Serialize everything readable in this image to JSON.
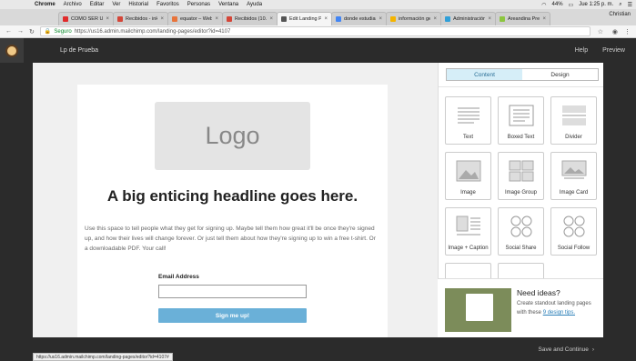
{
  "macos": {
    "menu": [
      "Chrome",
      "Archivo",
      "Editar",
      "Ver",
      "Historial",
      "Favoritos",
      "Personas",
      "Ventana",
      "Ayuda"
    ],
    "battery": "44%",
    "clock": "Jue 1:25 p. m."
  },
  "browser": {
    "tabs": [
      {
        "label": "CÓMO SER Un",
        "color": "#e02b2b",
        "active": false
      },
      {
        "label": "Recibidos - ink",
        "color": "#d44638",
        "active": false
      },
      {
        "label": "equator – Web",
        "color": "#e8743b",
        "active": false
      },
      {
        "label": "Recibidos (10.6",
        "color": "#d44638",
        "active": false
      },
      {
        "label": "Edit Landing Pa",
        "color": "#555555",
        "active": true
      },
      {
        "label": "donde estudiar",
        "color": "#4285f4",
        "active": false
      },
      {
        "label": "información ge",
        "color": "#f4b400",
        "active": false
      },
      {
        "label": "Administración",
        "color": "#2f9fd8",
        "active": false
      },
      {
        "label": "Areandina Pres",
        "color": "#8cc63f",
        "active": false
      }
    ],
    "user": "Christian",
    "secure_label": "Seguro",
    "url": "https://us16.admin.mailchimp.com/landing-pages/editor?id=4107"
  },
  "app": {
    "page_name": "Lp de Prueba",
    "help": "Help",
    "preview": "Preview"
  },
  "landing": {
    "logo": "Logo",
    "headline": "A big enticing headline goes here.",
    "body": "Use this space to tell people what they get for signing up. Maybe tell them how great it'll be once they're signed up, and how their lives will change forever. Or just tell them about how they're signing up to win a free t-shirt. Or a downloadable PDF. Your call!",
    "email_label": "Email Address",
    "signup_button": "Sign me up!"
  },
  "panel": {
    "tab_content": "Content",
    "tab_design": "Design",
    "blocks": [
      {
        "label": "Text",
        "icon": "text-block-icon"
      },
      {
        "label": "Boxed Text",
        "icon": "boxed-text-icon"
      },
      {
        "label": "Divider",
        "icon": "divider-icon"
      },
      {
        "label": "Image",
        "icon": "image-icon"
      },
      {
        "label": "Image Group",
        "icon": "image-group-icon"
      },
      {
        "label": "Image Card",
        "icon": "image-card-icon"
      },
      {
        "label": "Image + Caption",
        "icon": "image-caption-icon"
      },
      {
        "label": "Social Share",
        "icon": "social-share-icon"
      },
      {
        "label": "Social Follow",
        "icon": "social-follow-icon"
      }
    ],
    "need_ideas_title": "Need ideas?",
    "need_ideas_text": "Create standout landing pages with these",
    "need_ideas_link": "9 design tips."
  },
  "footer": {
    "save_continue": "Save and Continue",
    "status_url": "https://us16.admin.mailchimp.com/landing-pages/editor?id=4107#"
  }
}
